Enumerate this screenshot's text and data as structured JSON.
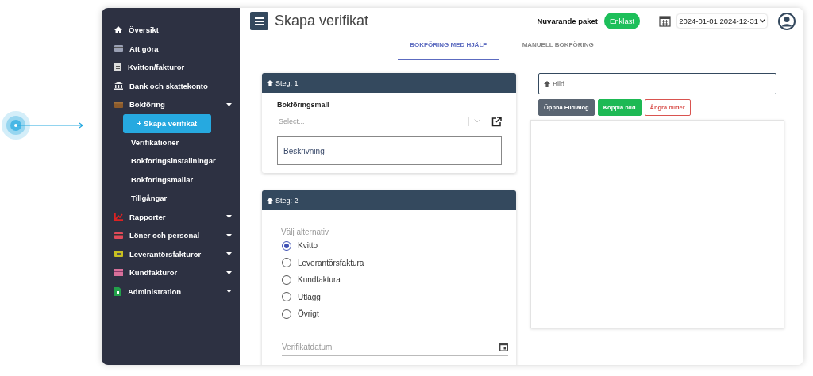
{
  "sidebar": {
    "items": [
      {
        "label": "Översikt",
        "kind": "link"
      },
      {
        "label": "Att göra",
        "kind": "link"
      },
      {
        "label": "Kvitton/fakturor",
        "kind": "link"
      },
      {
        "label": "Bank och skattekonto",
        "kind": "link"
      },
      {
        "label": "Bokföring",
        "kind": "group",
        "children": [
          {
            "label": "+ Skapa verifikat",
            "selected": true
          },
          {
            "label": "Verifikationer",
            "selected": false
          },
          {
            "label": "Bokföringsinställningar",
            "selected": false
          },
          {
            "label": "Bokföringsmallar",
            "selected": false
          },
          {
            "label": "Tillgångar",
            "selected": false
          }
        ]
      },
      {
        "label": "Rapporter",
        "kind": "group"
      },
      {
        "label": "Löner och personal",
        "kind": "group"
      },
      {
        "label": "Leverantörsfakturor",
        "kind": "group"
      },
      {
        "label": "Kundfakturor",
        "kind": "group"
      },
      {
        "label": "Administration",
        "kind": "group"
      }
    ]
  },
  "header": {
    "title": "Skapa verifikat",
    "package_label": "Nuvarande paket",
    "package": "Enklast",
    "date_range": "2024-01-01 2024-12-31"
  },
  "tabs": [
    {
      "label": "BOKFÖRING MED HJÄLP",
      "selected": true
    },
    {
      "label": "MANUELL BOKFÖRING",
      "selected": false
    }
  ],
  "step1": {
    "title": "Steg: 1",
    "template_label": "Bokföringsmall",
    "template_placeholder": "Select...",
    "description_placeholder": "Beskrivning"
  },
  "step2": {
    "title": "Steg: 2",
    "options_label": "Välj alternativ",
    "options": [
      {
        "label": "Kvitto",
        "selected": true
      },
      {
        "label": "Leverantörsfaktura",
        "selected": false
      },
      {
        "label": "Kundfaktura",
        "selected": false
      },
      {
        "label": "Utlägg",
        "selected": false
      },
      {
        "label": "Övrigt",
        "selected": false
      }
    ],
    "date_placeholder": "Verifikatdatum"
  },
  "image_panel": {
    "title": "Bild",
    "buttons": [
      {
        "label": "Öppna Fildialog",
        "kind": "secondary"
      },
      {
        "label": "Koppla bild",
        "kind": "success"
      },
      {
        "label": "Ångra bilder",
        "kind": "danger"
      }
    ]
  }
}
